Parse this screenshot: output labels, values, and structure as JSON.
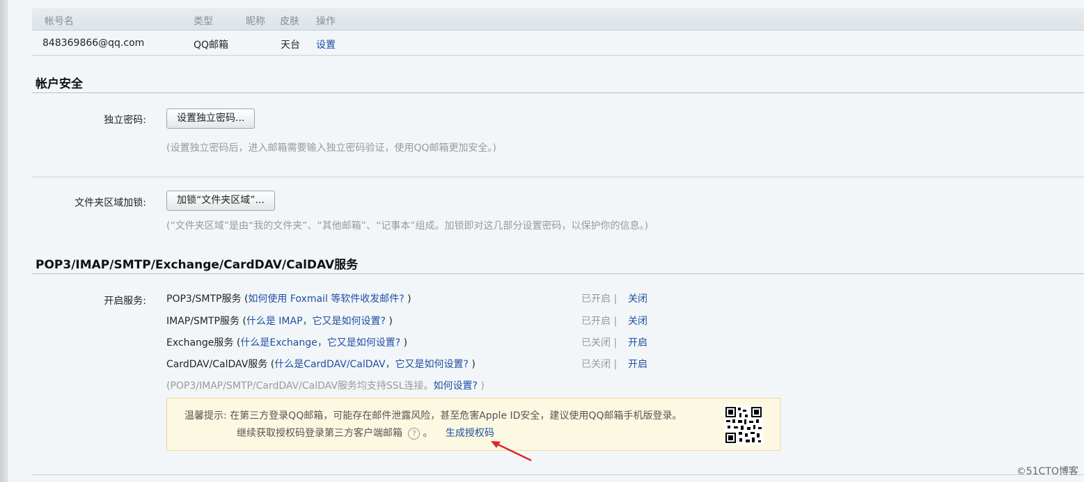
{
  "accounts_table": {
    "headers": {
      "account": "帐号名",
      "type": "类型",
      "nickname": "昵称",
      "skin": "皮肤",
      "action": "操作"
    },
    "rows": [
      {
        "account": "848369866@qq.com",
        "type": "QQ邮箱",
        "nickname": "",
        "skin": "天台",
        "action": "设置"
      }
    ]
  },
  "account_security": {
    "title": "帐户安全",
    "independent_password": {
      "label": "独立密码:",
      "button": "设置独立密码...",
      "hint": "(设置独立密码后，进入邮箱需要输入独立密码验证，使用QQ邮箱更加安全。)"
    },
    "folder_lock": {
      "label": "文件夹区域加锁:",
      "button": "加锁“文件夹区域”...",
      "hint": "(“文件夹区域”是由“我的文件夹”、“其他邮箱”、“记事本”组成。加锁即对这几部分设置密码，以保护你的信息。)"
    }
  },
  "services": {
    "title": "POP3/IMAP/SMTP/Exchange/CardDAV/CalDAV服务",
    "label": "开启服务:",
    "items": [
      {
        "name": "POP3/SMTP服务",
        "open": " (",
        "help": "如何使用 Foxmail 等软件收发邮件?",
        "close": " )",
        "status": "已开启 |",
        "action": "关闭"
      },
      {
        "name": "IMAP/SMTP服务",
        "open": " (",
        "help": "什么是 IMAP，它又是如何设置?",
        "close": " )",
        "status": "已开启 |",
        "action": "关闭"
      },
      {
        "name": "Exchange服务",
        "open": " (",
        "help": "什么是Exchange，它又是如何设置?",
        "close": " )",
        "status": "已关闭 |",
        "action": "开启"
      },
      {
        "name": "CardDAV/CalDAV服务",
        "open": " (",
        "help": "什么是CardDAV/CalDAV，它又是如何设置?",
        "close": " )",
        "status": "已关闭 |",
        "action": "开启"
      }
    ],
    "ssl_note": "(POP3/IMAP/SMTP/CardDAV/CalDAV服务均支持SSL连接。",
    "ssl_link": "如何设置?",
    "ssl_close": " )",
    "tip": {
      "prefix": "温馨提示:",
      "line1": "在第三方登录QQ邮箱，可能存在邮件泄露风险，甚至危害Apple ID安全，建议使用QQ邮箱手机版登录。",
      "line2": "继续获取授权码登录第三方客户端邮箱",
      "help_glyph": "?",
      "after_help": "。",
      "generate_link": "生成授权码"
    }
  },
  "watermark": "©51CTO博客",
  "colors": {
    "link": "#1e4fa3",
    "muted": "#999999",
    "tip_bg": "#fdf8e1",
    "arrow": "#d9262c"
  }
}
